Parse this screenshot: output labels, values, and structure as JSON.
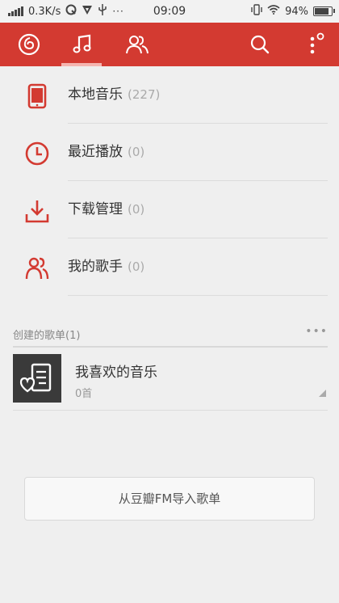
{
  "status_bar": {
    "speed": "0.3K/s",
    "time": "09:09",
    "battery": "94%"
  },
  "title_bar": {
    "tabs": [
      {
        "icon": "netease-logo-icon"
      },
      {
        "icon": "music-note-icon",
        "selected": true
      },
      {
        "icon": "friends-icon"
      }
    ],
    "actions": [
      {
        "icon": "search-icon"
      },
      {
        "icon": "more-vertical-icon"
      }
    ]
  },
  "nav": {
    "items": [
      {
        "label": "本地音乐",
        "count": "(227)",
        "icon": "tablet-icon"
      },
      {
        "label": "最近播放",
        "count": "(0)",
        "icon": "clock-icon"
      },
      {
        "label": "下载管理",
        "count": "(0)",
        "icon": "download-icon"
      },
      {
        "label": "我的歌手",
        "count": "(0)",
        "icon": "singers-icon"
      }
    ]
  },
  "playlists": {
    "title": "创建的歌单(1)",
    "more": "•••",
    "items": [
      {
        "name": "我喜欢的音乐",
        "count": "0首",
        "icon": "liked-playlist-icon"
      }
    ]
  },
  "import_button": {
    "label": "从豆瓣FM导入歌单"
  },
  "colors": {
    "accent": "#d33a31",
    "background": "#efefef"
  }
}
